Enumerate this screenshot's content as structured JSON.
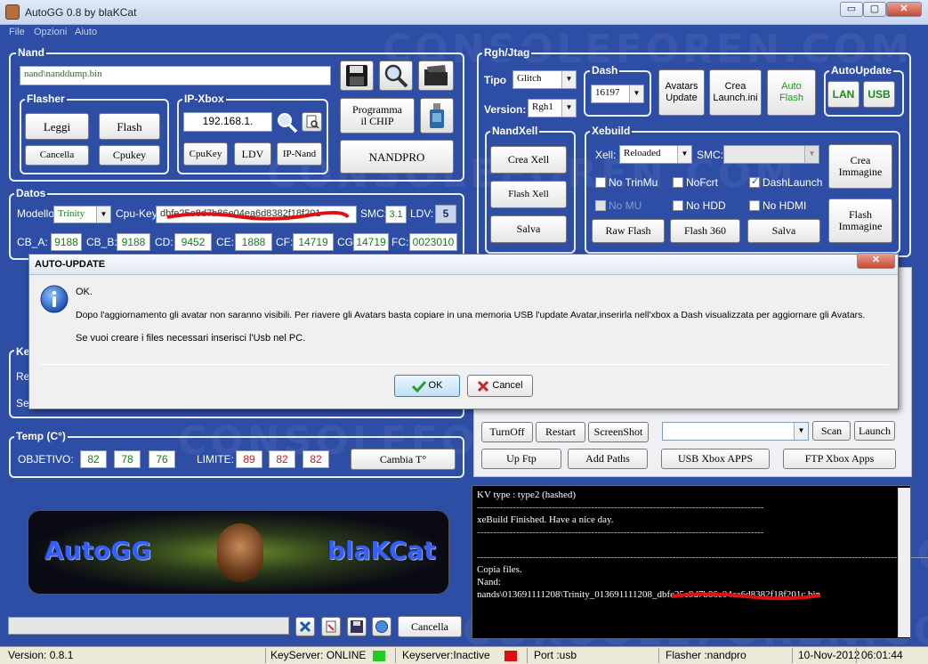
{
  "window": {
    "title": "AutoGG 0.8 by blaKCat",
    "minimize": "▭",
    "restore": "▢",
    "close": "✕"
  },
  "menu": [
    "File",
    "Opzioni",
    "Aiuto"
  ],
  "watermark": "CONSOLEFOREN.COM",
  "nand": {
    "label": "Nand",
    "path": "nand\\nanddump.bin",
    "save_icon": "floppy-disk-icon",
    "search_icon": "magnifier-icon",
    "folder_icon": "folder-icon"
  },
  "flasher": {
    "label": "Flasher",
    "leggi": "Leggi",
    "flash": "Flash",
    "cancella": "Cancella",
    "cpukey": "Cpukey"
  },
  "ipxbox": {
    "label": "IP-Xbox",
    "ip": "192.168.1.",
    "cpukey": "CpuKey",
    "ldv": "LDV",
    "ipnand": "IP-Nand"
  },
  "programma": {
    "label": "Programma il CHIP",
    "usb_icon": "usb-drive-icon",
    "nandpro": "NANDPRO"
  },
  "datos": {
    "label": "Datos",
    "modello_label": "Modello:",
    "modello": "Trinity",
    "cpukey_label": "Cpu-Key:",
    "cpukey_value": "dbfe25e8d7b86e04ea6d8382f18f201",
    "smc_label": "SMC:",
    "smc": "3.1",
    "ldv_label": "LDV:",
    "ldv": "5",
    "fields": [
      {
        "label": "CB_A:",
        "value": "9188"
      },
      {
        "label": "CB_B:",
        "value": "9188"
      },
      {
        "label": "CD:",
        "value": "9452"
      },
      {
        "label": "CE:",
        "value": "1888"
      },
      {
        "label": "CF:",
        "value": "14719"
      },
      {
        "label": "CG:",
        "value": "14719"
      },
      {
        "label": "FC:",
        "value": "0023010"
      }
    ]
  },
  "rgh": {
    "label": "Rgh/Jtag",
    "tipo_label": "Tipo",
    "tipo": "Glitch",
    "version_label": "Version:",
    "version": "Rgh1"
  },
  "dash": {
    "label": "Dash",
    "value": "16197"
  },
  "avatars": "Avatars Update",
  "crea_launch": "Crea Launch.ini",
  "auto_flash": "Auto Flash",
  "autoupdate": {
    "label": "AutoUpdate",
    "lan": "LAN",
    "usb": "USB"
  },
  "nandxell": {
    "label": "NandXell",
    "crea": "Crea Xell",
    "flash": "Flash Xell",
    "salva": "Salva"
  },
  "xebuild": {
    "label": "Xebuild",
    "xell_label": "Xell:",
    "xell": "Reloaded",
    "smc_label": "SMC:",
    "crea_immagine": "Crea Immagine",
    "flash_immagine": "Flash Immagine",
    "checks": [
      {
        "label": "No TrinMu",
        "checked": false,
        "enabled": true
      },
      {
        "label": "NoFcrt",
        "checked": false,
        "enabled": true
      },
      {
        "label": "DashLaunch",
        "checked": true,
        "enabled": true
      },
      {
        "label": "No MU",
        "checked": false,
        "enabled": false
      },
      {
        "label": "No HDD",
        "checked": false,
        "enabled": true
      },
      {
        "label": "No HDMI",
        "checked": false,
        "enabled": true
      }
    ],
    "raw_flash": "Raw Flash",
    "flash360": "Flash 360",
    "salva": "Salva"
  },
  "key_section": {
    "label": "Ke",
    "r1": "Re",
    "r2": "Se"
  },
  "temp": {
    "label": "Temp (C°)",
    "objetivo_label": "OBJETIVO:",
    "objetivo": [
      "82",
      "78",
      "76"
    ],
    "limite_label": "LIMITE:",
    "limite": [
      "89",
      "82",
      "82"
    ],
    "cambia": "Cambia T°"
  },
  "tools": {
    "turnoff": "TurnOff",
    "restart": "Restart",
    "screenshot": "ScreenShot",
    "scan": "Scan",
    "launch": "Launch",
    "upftp": "Up Ftp",
    "addpaths": "Add Paths",
    "usbapps": "USB Xbox APPS",
    "ftpapps": "FTP Xbox Apps"
  },
  "console": {
    "lines": [
      "KV type   : type2 (hashed)",
      "----------------------------------------------------------------------------------------",
      "   xeBuild Finished. Have a nice day.",
      "----------------------------------------------------------------------------------------",
      "",
      "------------------------------------------------------------------------------------------------------------------------------------------------------",
      "Copia files.",
      "Nand:",
      "nands\\013691111208\\Trinity_013691111208_dbfe25e8d7b86e04ea6d8382f18f201c.bin"
    ]
  },
  "logo": {
    "left": "AutoGG",
    "right": "blaKCat"
  },
  "bottom": {
    "cancella": "Cancella"
  },
  "status": {
    "version": "Version: 0.8.1",
    "keyserver": "KeyServer: ONLINE",
    "keyserver2": "Keyserver:Inactive",
    "port": "Port :usb",
    "flasher": "Flasher :nandpro",
    "date": "10-Nov-2012",
    "time": "06:01:44",
    "online_color": "#22cc22",
    "inactive_color": "#dd1111"
  },
  "dialog": {
    "title": "AUTO-UPDATE",
    "line1": "OK.",
    "line2": "Dopo l'aggiornamento gli avatar non saranno visibili. Per riavere gli Avatars basta copiare in una memoria USB l'update Avatar,inserirla nell'xbox a Dash visualizzata per aggiornare gli Avatars.",
    "line3": "Se vuoi creare i files necessari inserisci l'Usb nel PC.",
    "ok": "OK",
    "cancel": "Cancel",
    "close": "✕"
  }
}
